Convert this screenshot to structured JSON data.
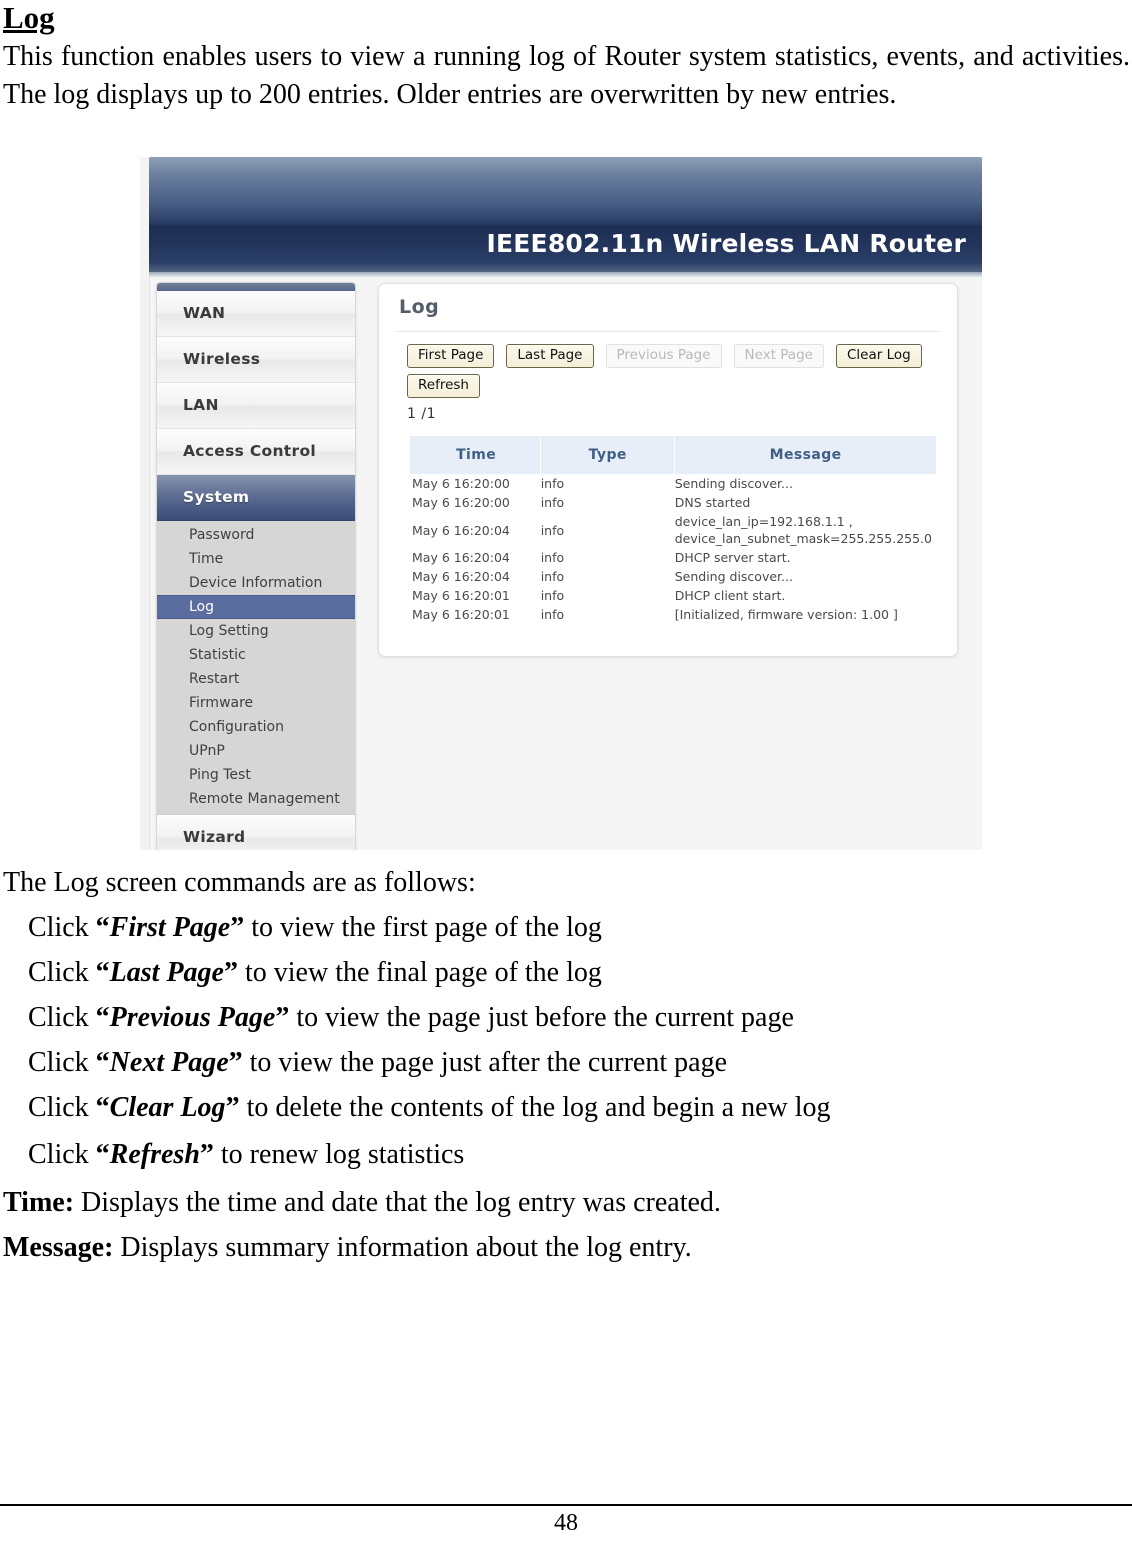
{
  "document": {
    "heading": "Log",
    "intro": "This function enables users to view a running log of Router system statistics, events, and activities. The log displays up to 200 entries. Older entries are overwritten by new entries.",
    "commands_lead": "The Log screen commands are as follows:",
    "commands": [
      {
        "click": "Click ",
        "open_quote": "“",
        "name": "First Page",
        "close_quote": "”",
        "rest": " to view the first page of the log"
      },
      {
        "click": "Click ",
        "open_quote": "“",
        "name": "Last Page",
        "close_quote": "”",
        "rest": " to view the final page of the log"
      },
      {
        "click": "Click ",
        "open_quote": "“",
        "name": "Previous Page",
        "close_quote": "”",
        "rest": " to view the page just before the current page"
      },
      {
        "click": "Click ",
        "open_quote": "“",
        "name": "Next Page",
        "close_quote": "”",
        "rest": " to view the page just after the current page"
      },
      {
        "click": "Click ",
        "open_quote": "“",
        "name": "Clear Log",
        "close_quote": "”",
        "rest": " to delete the contents of the log and begin a new log"
      },
      {
        "click": "Click ",
        "open_quote": "“",
        "name": "Refresh",
        "close_quote": "”",
        "rest": " to renew log statistics"
      }
    ],
    "definitions": [
      {
        "term": "Time:",
        "desc": " Displays the time and date that the log entry was created."
      },
      {
        "term": "Message:",
        "desc": " Displays summary information about the log entry."
      }
    ],
    "page_number": "48"
  },
  "router_ui": {
    "header_title": "IEEE802.11n  Wireless LAN Router",
    "colors": {
      "header_gradient_top": "#8f9fb6",
      "header_gradient_mid": "#1d2e53",
      "active_menu_blue": "#4c5d86",
      "active_submenu_blue": "#5a6d9e",
      "table_header_bg": "#e8eef7",
      "table_header_text": "#3f5f86",
      "button_face": "#f7f4e4",
      "button_border": "#6b6645",
      "panel_title_text": "#555f6b"
    },
    "sidebar": {
      "items": [
        {
          "label": "WAN",
          "active": false
        },
        {
          "label": "Wireless",
          "active": false
        },
        {
          "label": "LAN",
          "active": false
        },
        {
          "label": "Access Control",
          "active": false
        },
        {
          "label": "System",
          "active": true
        },
        {
          "label": "Wizard",
          "active": false
        }
      ],
      "submenu": [
        {
          "label": "Password",
          "active": false
        },
        {
          "label": "Time",
          "active": false
        },
        {
          "label": "Device Information",
          "active": false
        },
        {
          "label": "Log",
          "active": true
        },
        {
          "label": "Log Setting",
          "active": false
        },
        {
          "label": "Statistic",
          "active": false
        },
        {
          "label": "Restart",
          "active": false
        },
        {
          "label": "Firmware",
          "active": false
        },
        {
          "label": "Configuration",
          "active": false
        },
        {
          "label": "UPnP",
          "active": false
        },
        {
          "label": "Ping Test",
          "active": false
        },
        {
          "label": "Remote Management",
          "active": false
        }
      ]
    },
    "panel": {
      "title": "Log",
      "buttons": [
        {
          "label": "First Page",
          "disabled": false
        },
        {
          "label": "Last Page",
          "disabled": false
        },
        {
          "label": "Previous Page",
          "disabled": true
        },
        {
          "label": "Next Page",
          "disabled": true
        },
        {
          "label": "Clear Log",
          "disabled": false
        },
        {
          "label": "Refresh",
          "disabled": false
        }
      ],
      "page_indicator": "1 /1",
      "table": {
        "columns": [
          "Time",
          "Type",
          "Message"
        ],
        "rows": [
          {
            "time": "May 6 16:20:00",
            "type": "info",
            "message": "Sending discover..."
          },
          {
            "time": "May 6 16:20:00",
            "type": "info",
            "message": "DNS started"
          },
          {
            "time": "May 6 16:20:04",
            "type": "info",
            "message": "device_lan_ip=192.168.1.1 ,\ndevice_lan_subnet_mask=255.255.255.0"
          },
          {
            "time": "May 6 16:20:04",
            "type": "info",
            "message": "DHCP server start."
          },
          {
            "time": "May 6 16:20:04",
            "type": "info",
            "message": "Sending discover..."
          },
          {
            "time": "May 6 16:20:01",
            "type": "info",
            "message": "DHCP client start."
          },
          {
            "time": "May 6 16:20:01",
            "type": "info",
            "message": "[Initialized, firmware version: 1.00 ]"
          }
        ]
      }
    }
  }
}
